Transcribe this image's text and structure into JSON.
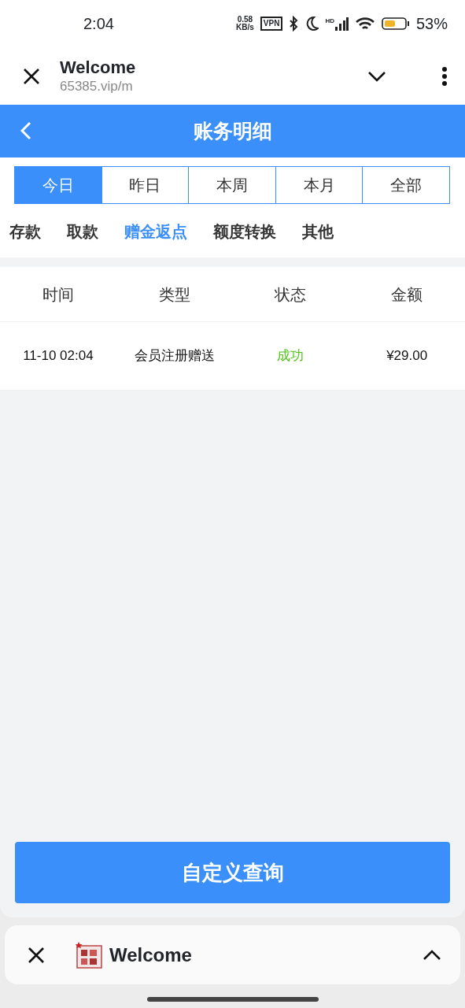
{
  "status_bar": {
    "time": "2:04",
    "net_speed": [
      "0.58",
      "KB/s"
    ],
    "vpn": "VPN",
    "signal_label": "HD",
    "battery": "53%"
  },
  "browser": {
    "title": "Welcome",
    "url": "65385.vip/m"
  },
  "header": {
    "title": "账务明细"
  },
  "period_tabs": [
    {
      "label": "今日",
      "selected": true
    },
    {
      "label": "昨日",
      "selected": false
    },
    {
      "label": "本周",
      "selected": false
    },
    {
      "label": "本月",
      "selected": false
    },
    {
      "label": "全部",
      "selected": false
    }
  ],
  "categories": [
    {
      "label": "存款",
      "selected": false
    },
    {
      "label": "取款",
      "selected": false
    },
    {
      "label": "赠金返点",
      "selected": true
    },
    {
      "label": "额度转换",
      "selected": false
    },
    {
      "label": "其他",
      "selected": false
    }
  ],
  "table": {
    "columns": [
      "时间",
      "类型",
      "状态",
      "金额"
    ],
    "rows": [
      {
        "time": "11-10 02:04",
        "type": "会员注册赠送",
        "status": "成功",
        "color": "#52c41a",
        "amount": "¥29.00"
      }
    ]
  },
  "query_button": "自定义查询",
  "tab_bar": {
    "title": "Welcome"
  }
}
